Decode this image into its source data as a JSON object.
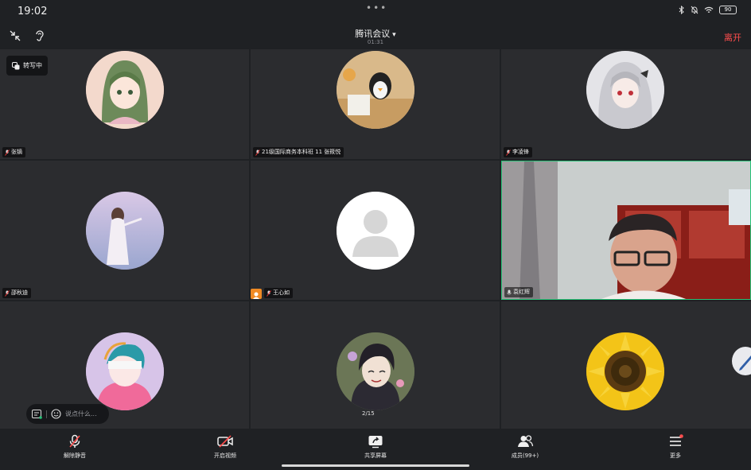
{
  "status_bar": {
    "time": "19:02",
    "battery": "90"
  },
  "header": {
    "title": "腾讯会议",
    "timer": "01:31",
    "leave_label": "离开"
  },
  "transcribe": {
    "label": "转写中"
  },
  "participants": [
    {
      "name": "张镝",
      "avatar": "anime-girl-green-hair"
    },
    {
      "name": "21级国际商务本科班 11 张筱悦",
      "avatar": "penguin-plush"
    },
    {
      "name": "李凌锋",
      "avatar": "anime-girl-white-hair"
    },
    {
      "name": "邵秋迪",
      "avatar": "girl-by-sea"
    },
    {
      "name": "王心如",
      "avatar": "default-avatar"
    },
    {
      "name": "袁红辉",
      "avatar": "live-video"
    },
    {
      "name": "",
      "avatar": "anime-pink-hoodie"
    },
    {
      "name": "",
      "avatar": "anime-boy-dark-hair"
    },
    {
      "name": "",
      "avatar": "sunflower"
    }
  ],
  "pager": "2/15",
  "chat": {
    "placeholder": "说点什么..."
  },
  "toolbar": {
    "unmute_label": "解除静音",
    "video_label": "开启视频",
    "share_label": "共享屏幕",
    "members_label": "成员(99+)",
    "more_label": "更多"
  },
  "colors": {
    "leave": "#ff4d4d",
    "active_speaker": "#27c277",
    "host_badge": "#f08a24"
  }
}
